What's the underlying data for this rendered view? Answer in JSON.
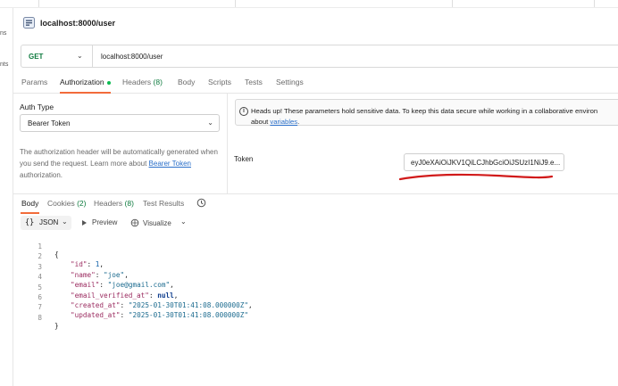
{
  "sidebar_fragments": [
    "ns",
    "nts"
  ],
  "request": {
    "title": "localhost:8000/user",
    "method": "GET",
    "url": "localhost:8000/user"
  },
  "request_tabs": [
    {
      "label": "Params"
    },
    {
      "label": "Authorization"
    },
    {
      "label": "Headers",
      "count": "(8)"
    },
    {
      "label": "Body"
    },
    {
      "label": "Scripts"
    },
    {
      "label": "Tests"
    },
    {
      "label": "Settings"
    }
  ],
  "auth": {
    "type_label": "Auth Type",
    "type_value": "Bearer Token",
    "description_prefix": "The authorization header will be automatically generated when you send the request. Learn more about ",
    "description_link": "Bearer Token",
    "description_suffix": " authorization.",
    "heads_up_line1": "Heads up! These parameters hold sensitive data. To keep this data secure while working in a collaborative environ",
    "heads_up_line2_prefix": "about ",
    "heads_up_link": "variables",
    "heads_up_line2_suffix": ".",
    "token_label": "Token",
    "token_value": "eyJ0eXAiOiJKV1QiLCJhbGciOiJSUzI1NiJ9.e..."
  },
  "response_tabs": [
    {
      "label": "Body"
    },
    {
      "label": "Cookies",
      "count": "(2)"
    },
    {
      "label": "Headers",
      "count": "(8)"
    },
    {
      "label": "Test Results"
    }
  ],
  "response_toolbar": {
    "braces": "{}",
    "format": "JSON",
    "preview": "Preview",
    "visualize": "Visualize"
  },
  "response_body": {
    "line_numbers": [
      "1",
      "2",
      "3",
      "4",
      "5",
      "6",
      "7",
      "8"
    ],
    "open_brace": "{",
    "close_brace": "}",
    "fields": [
      {
        "key": "\"id\"",
        "value": "1",
        "type": "number"
      },
      {
        "key": "\"name\"",
        "value": "\"joe\"",
        "type": "string"
      },
      {
        "key": "\"email\"",
        "value": "\"joe@gmail.com\"",
        "type": "string"
      },
      {
        "key": "\"email_verified_at\"",
        "value": "null",
        "type": "null"
      },
      {
        "key": "\"created_at\"",
        "value": "\"2025-01-30T01:41:08.000000Z\"",
        "type": "string"
      },
      {
        "key": "\"updated_at\"",
        "value": "\"2025-01-30T01:41:08.000000Z\"",
        "type": "string"
      }
    ]
  },
  "colors": {
    "accent_orange": "#f26b3a",
    "method_green": "#0f7b3f",
    "status_dot": "#0cbb52",
    "link_blue": "#2a6fc9",
    "annotation_red": "#d11a1a"
  }
}
